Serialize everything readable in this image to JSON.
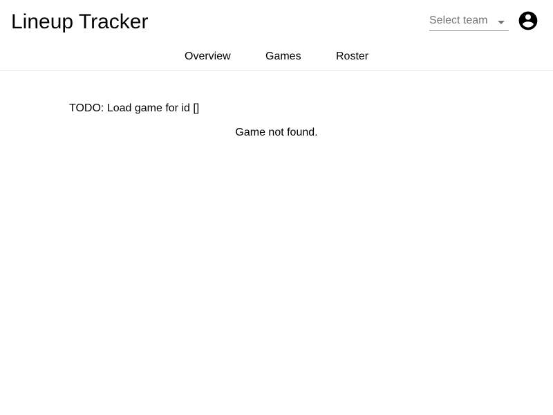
{
  "header": {
    "title": "Lineup Tracker",
    "team_select": {
      "placeholder": "Select team",
      "icon": "arrow-drop-down-icon"
    },
    "account_icon": "account-circle-icon"
  },
  "nav": {
    "tabs": [
      {
        "label": "Overview"
      },
      {
        "label": "Games"
      },
      {
        "label": "Roster"
      }
    ]
  },
  "main": {
    "todo_message": "TODO: Load game for id []",
    "status_message": "Game not found."
  },
  "colors": {
    "background": "#ffffff",
    "text": "#000000",
    "muted_text": "#757575",
    "divider": "#e6e6e6"
  }
}
